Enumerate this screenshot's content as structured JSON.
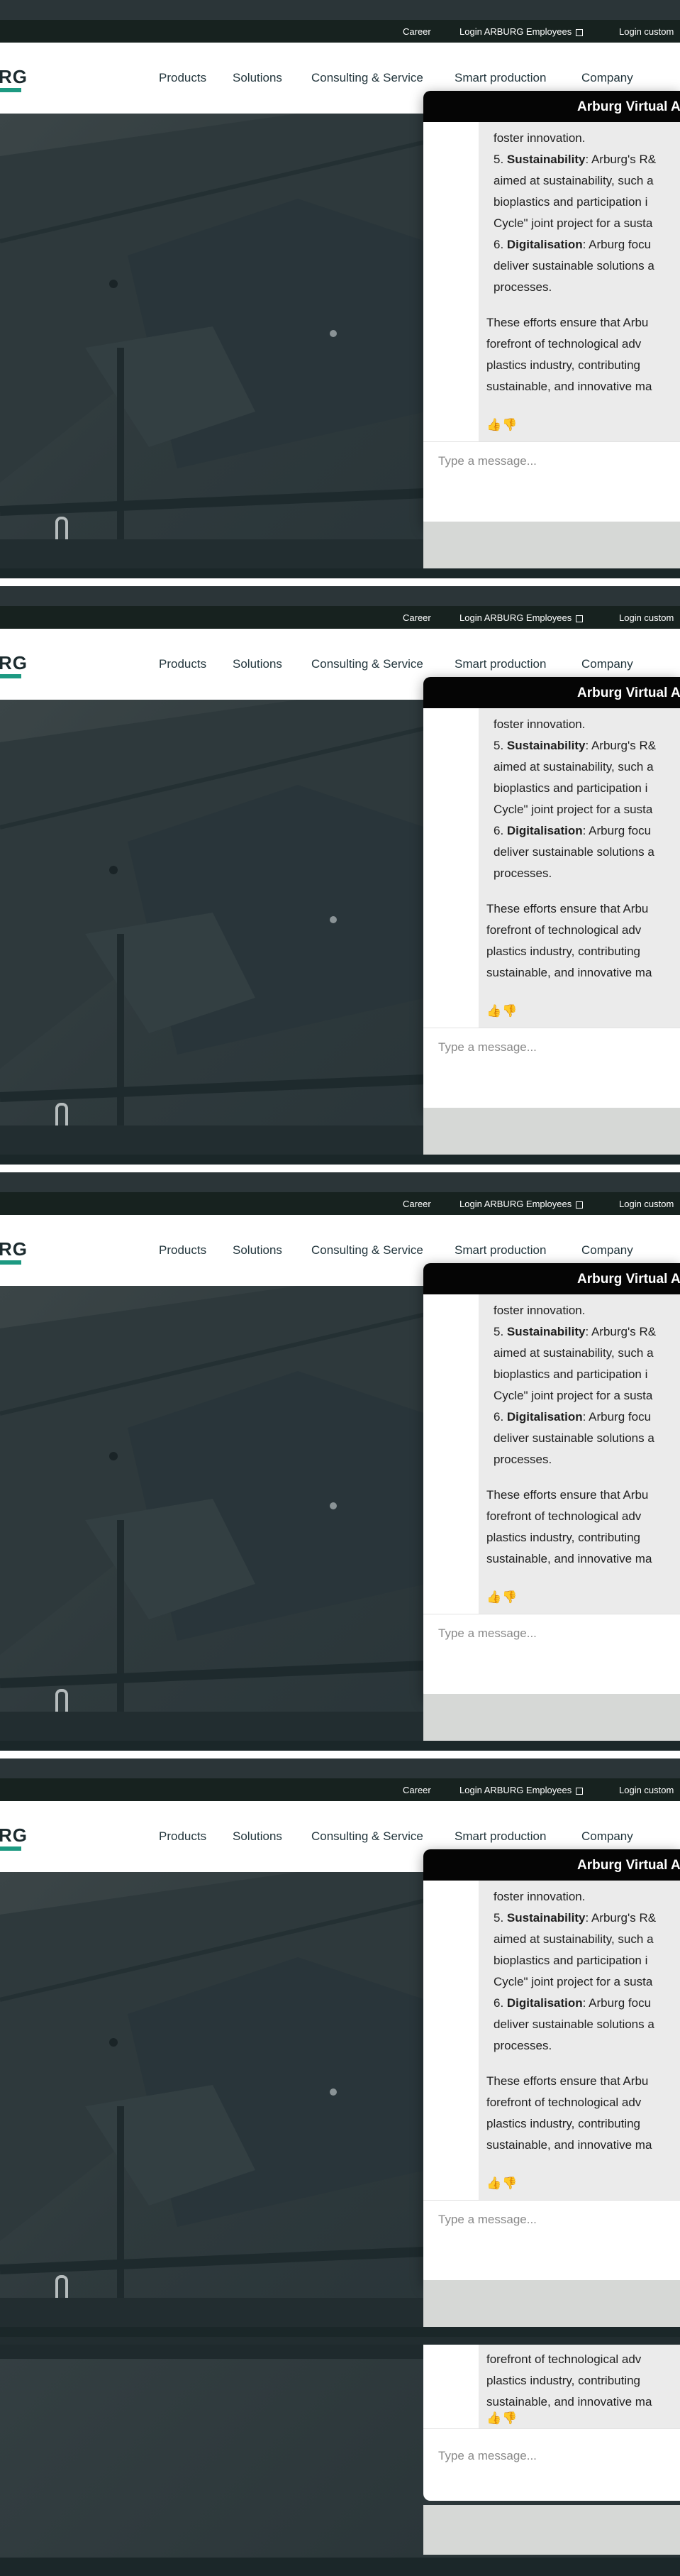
{
  "topbar": {
    "links": [
      {
        "label": "Career"
      },
      {
        "label": "Login ARBURG Employees"
      },
      {
        "label": "Login custom"
      }
    ]
  },
  "nav": {
    "logo_text": "RG",
    "items": [
      {
        "label": "Products"
      },
      {
        "label": "Solutions"
      },
      {
        "label": "Consulting & Service"
      },
      {
        "label": "Smart production"
      },
      {
        "label": "Company"
      }
    ]
  },
  "chat": {
    "title": "Arburg Virtual A",
    "line1": "foster innovation.",
    "item5_num": "5. ",
    "item5_bold": "Sustainability",
    "item5_rest": ": Arburg's R&",
    "line3": "aimed at sustainability, such a",
    "line4": "bioplastics and participation i",
    "line5": "Cycle\" joint project for a susta",
    "item6_num": "6. ",
    "item6_bold": "Digitalisation",
    "item6_rest": ": Arburg focu",
    "line7": "deliver sustainable solutions a",
    "line8": "processes.",
    "line9": "These efforts ensure that Arbu",
    "line10": "forefront of technological adv",
    "line11": "plastics industry, contributing",
    "line12": "sustainable, and innovative ma",
    "input_placeholder": "Type a message...",
    "thumbs_up_icon": "thumbs-up-icon",
    "thumbs_down_icon": "thumbs-down-icon"
  }
}
